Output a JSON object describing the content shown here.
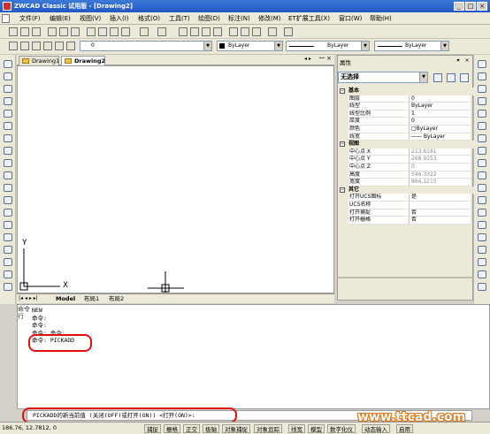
{
  "window": {
    "title": "ZWCAD Classic 试用版 - [Drawing2]",
    "minimize": "_",
    "maximize": "□",
    "close": "×"
  },
  "menu": [
    "文件(F)",
    "编辑(E)",
    "视图(V)",
    "插入(I)",
    "格式(O)",
    "工具(T)",
    "绘图(D)",
    "标注(N)",
    "修改(M)",
    "ET扩展工具(X)",
    "窗口(W)",
    "帮助(H)"
  ],
  "toolbar2": {
    "layer_value": "0",
    "color_value": "ByLayer",
    "linetype_value": "ByLayer",
    "lineweight_value": "ByLayer"
  },
  "doc_tabs": [
    "Drawing1",
    "Drawing2"
  ],
  "layout_tabs": [
    "Model",
    "布局1",
    "布局2"
  ],
  "canvas": {
    "axis_y": "Y",
    "axis_x": "X"
  },
  "properties": {
    "title": "属性",
    "selection": "无选择",
    "sections": [
      {
        "name": "基本",
        "rows": [
          {
            "k": "图层",
            "v": "0",
            "dim": false
          },
          {
            "k": "线型",
            "v": "ByLayer",
            "dim": false
          },
          {
            "k": "线型比例",
            "v": "1",
            "dim": false
          },
          {
            "k": "厚度",
            "v": "0",
            "dim": false
          },
          {
            "k": "颜色",
            "v": "□ByLayer",
            "dim": false
          },
          {
            "k": "线宽",
            "v": "—— ByLayer",
            "dim": false
          }
        ]
      },
      {
        "name": "视图",
        "rows": [
          {
            "k": "中心点 X",
            "v": "213.6181",
            "dim": true
          },
          {
            "k": "中心点 Y",
            "v": "268.9153",
            "dim": true
          },
          {
            "k": "中心点 Z",
            "v": "0",
            "dim": true
          },
          {
            "k": "高度",
            "v": "546.3322",
            "dim": true
          },
          {
            "k": "宽度",
            "v": "864.1215",
            "dim": true
          }
        ]
      },
      {
        "name": "其它",
        "rows": [
          {
            "k": "打开UCS图标",
            "v": "是",
            "dim": false
          },
          {
            "k": "UCS名称",
            "v": "",
            "dim": false
          },
          {
            "k": "打开捕捉",
            "v": "否",
            "dim": false
          },
          {
            "k": "打开栅格",
            "v": "否",
            "dim": false
          }
        ]
      }
    ]
  },
  "command": {
    "label": "命令行",
    "history": [
      "NEW",
      "命令:",
      "命令:",
      "命令: 命令:",
      "命令: PICKADD"
    ],
    "prompt": "PICKADD的新当前值 (关闭(OFF)或打开(ON)) <打开(ON)>:"
  },
  "status": {
    "coords": "186.76,  12.7812,  0",
    "buttons": [
      "捕捉",
      "栅格",
      "正交",
      "极轴",
      "对象捕捉",
      "对象追踪",
      "线宽",
      "模型",
      "数字化仪",
      "动态输入",
      "启用"
    ]
  },
  "watermark": "www.ttcad.com",
  "colors": {
    "titlebar": "#2157c4",
    "highlight_oval": "#e01010"
  }
}
